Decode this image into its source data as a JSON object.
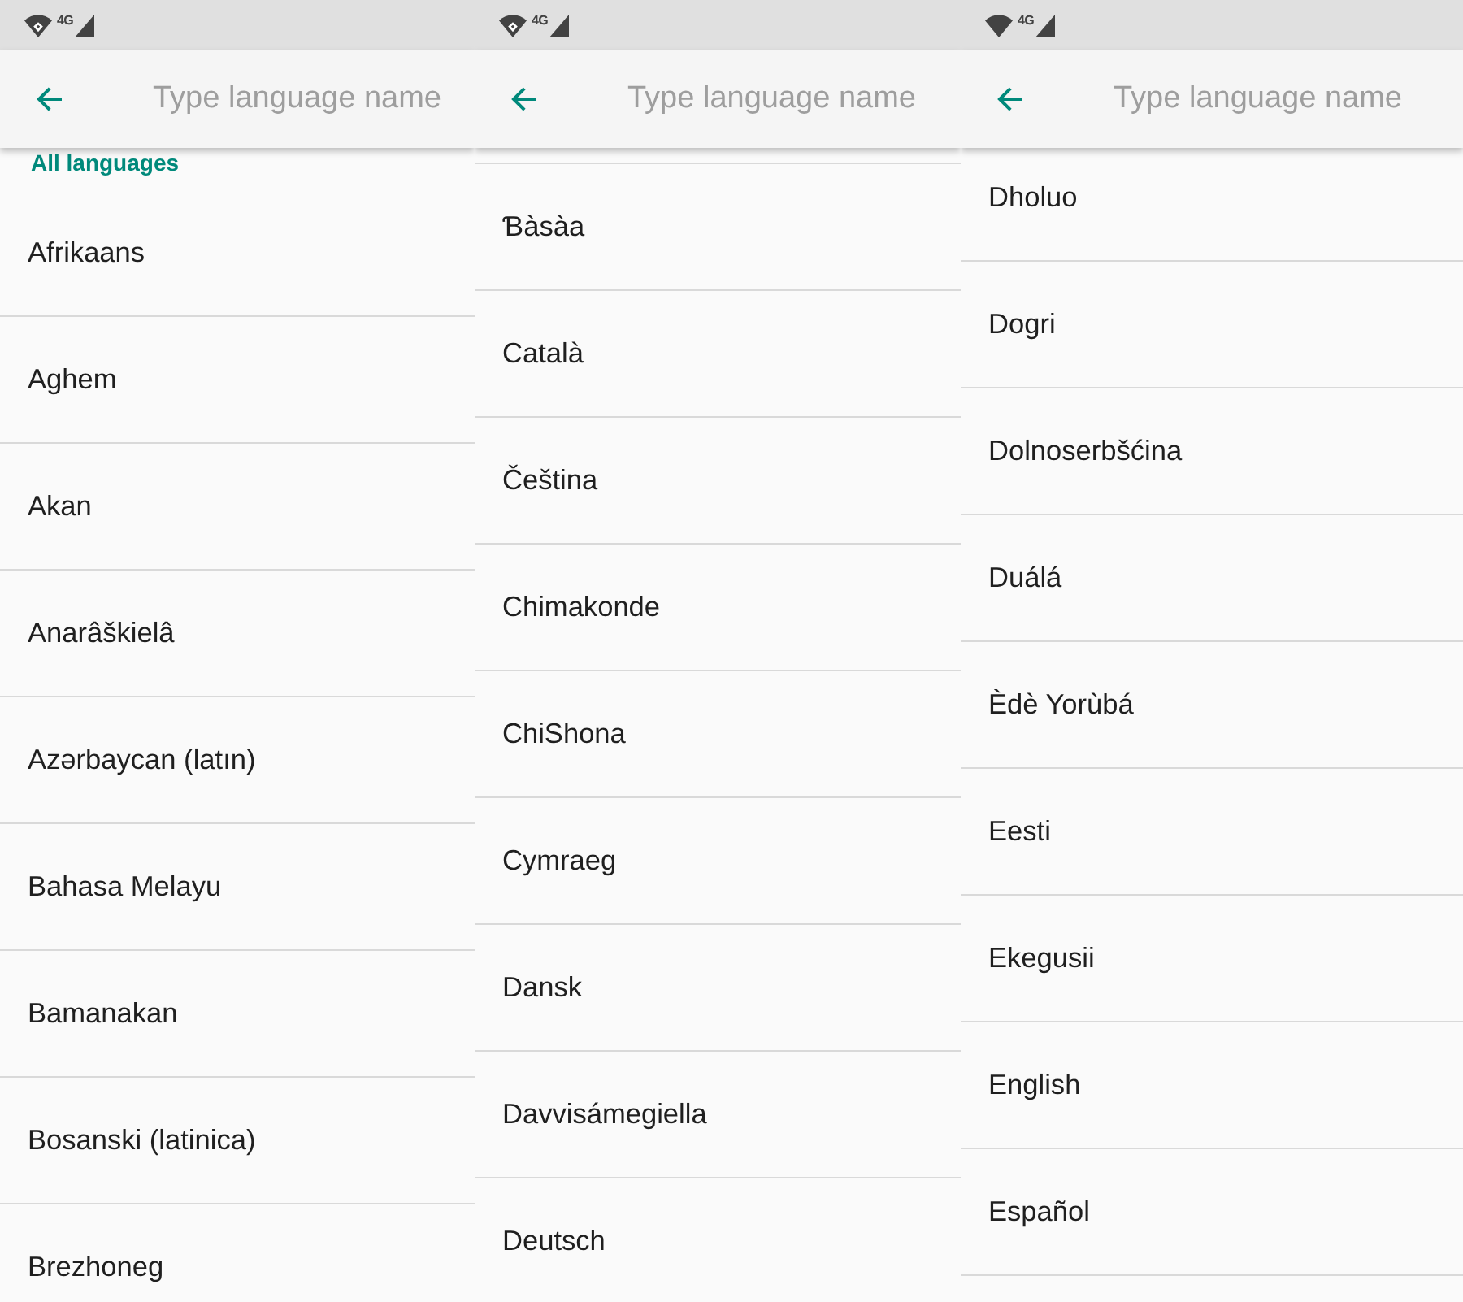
{
  "panels": [
    {
      "status_bar": {
        "network": "4G",
        "wifi_badge": true
      },
      "toolbar": {
        "search": {
          "placeholder": "Type language name"
        }
      },
      "list": {
        "header": "All languages",
        "items": [
          "Afrikaans",
          "Aghem",
          "Akan",
          "Anarâškielâ",
          "Azərbaycan (latın)",
          "Bahasa Melayu",
          "Bamanakan",
          "Bosanski (latinica)",
          "Brezhoneg"
        ]
      }
    },
    {
      "status_bar": {
        "network": "4G",
        "wifi_badge": true
      },
      "toolbar": {
        "search": {
          "placeholder": "Type language name"
        }
      },
      "list": {
        "items": [
          "Ɓàsàa",
          "Català",
          "Čeština",
          "Chimakonde",
          "ChiShona",
          "Cymraeg",
          "Dansk",
          "Davvisámegiella",
          "Deutsch"
        ]
      }
    },
    {
      "status_bar": {
        "network": "4G",
        "wifi_badge": false
      },
      "toolbar": {
        "search": {
          "placeholder": "Type language name"
        }
      },
      "list": {
        "items": [
          "Dholuo",
          "Dogri",
          "Dolnoserbšćina",
          "Duálá",
          "Èdè Yorùbá",
          "Eesti",
          "Ekegusii",
          "English",
          "Español"
        ]
      }
    }
  ]
}
